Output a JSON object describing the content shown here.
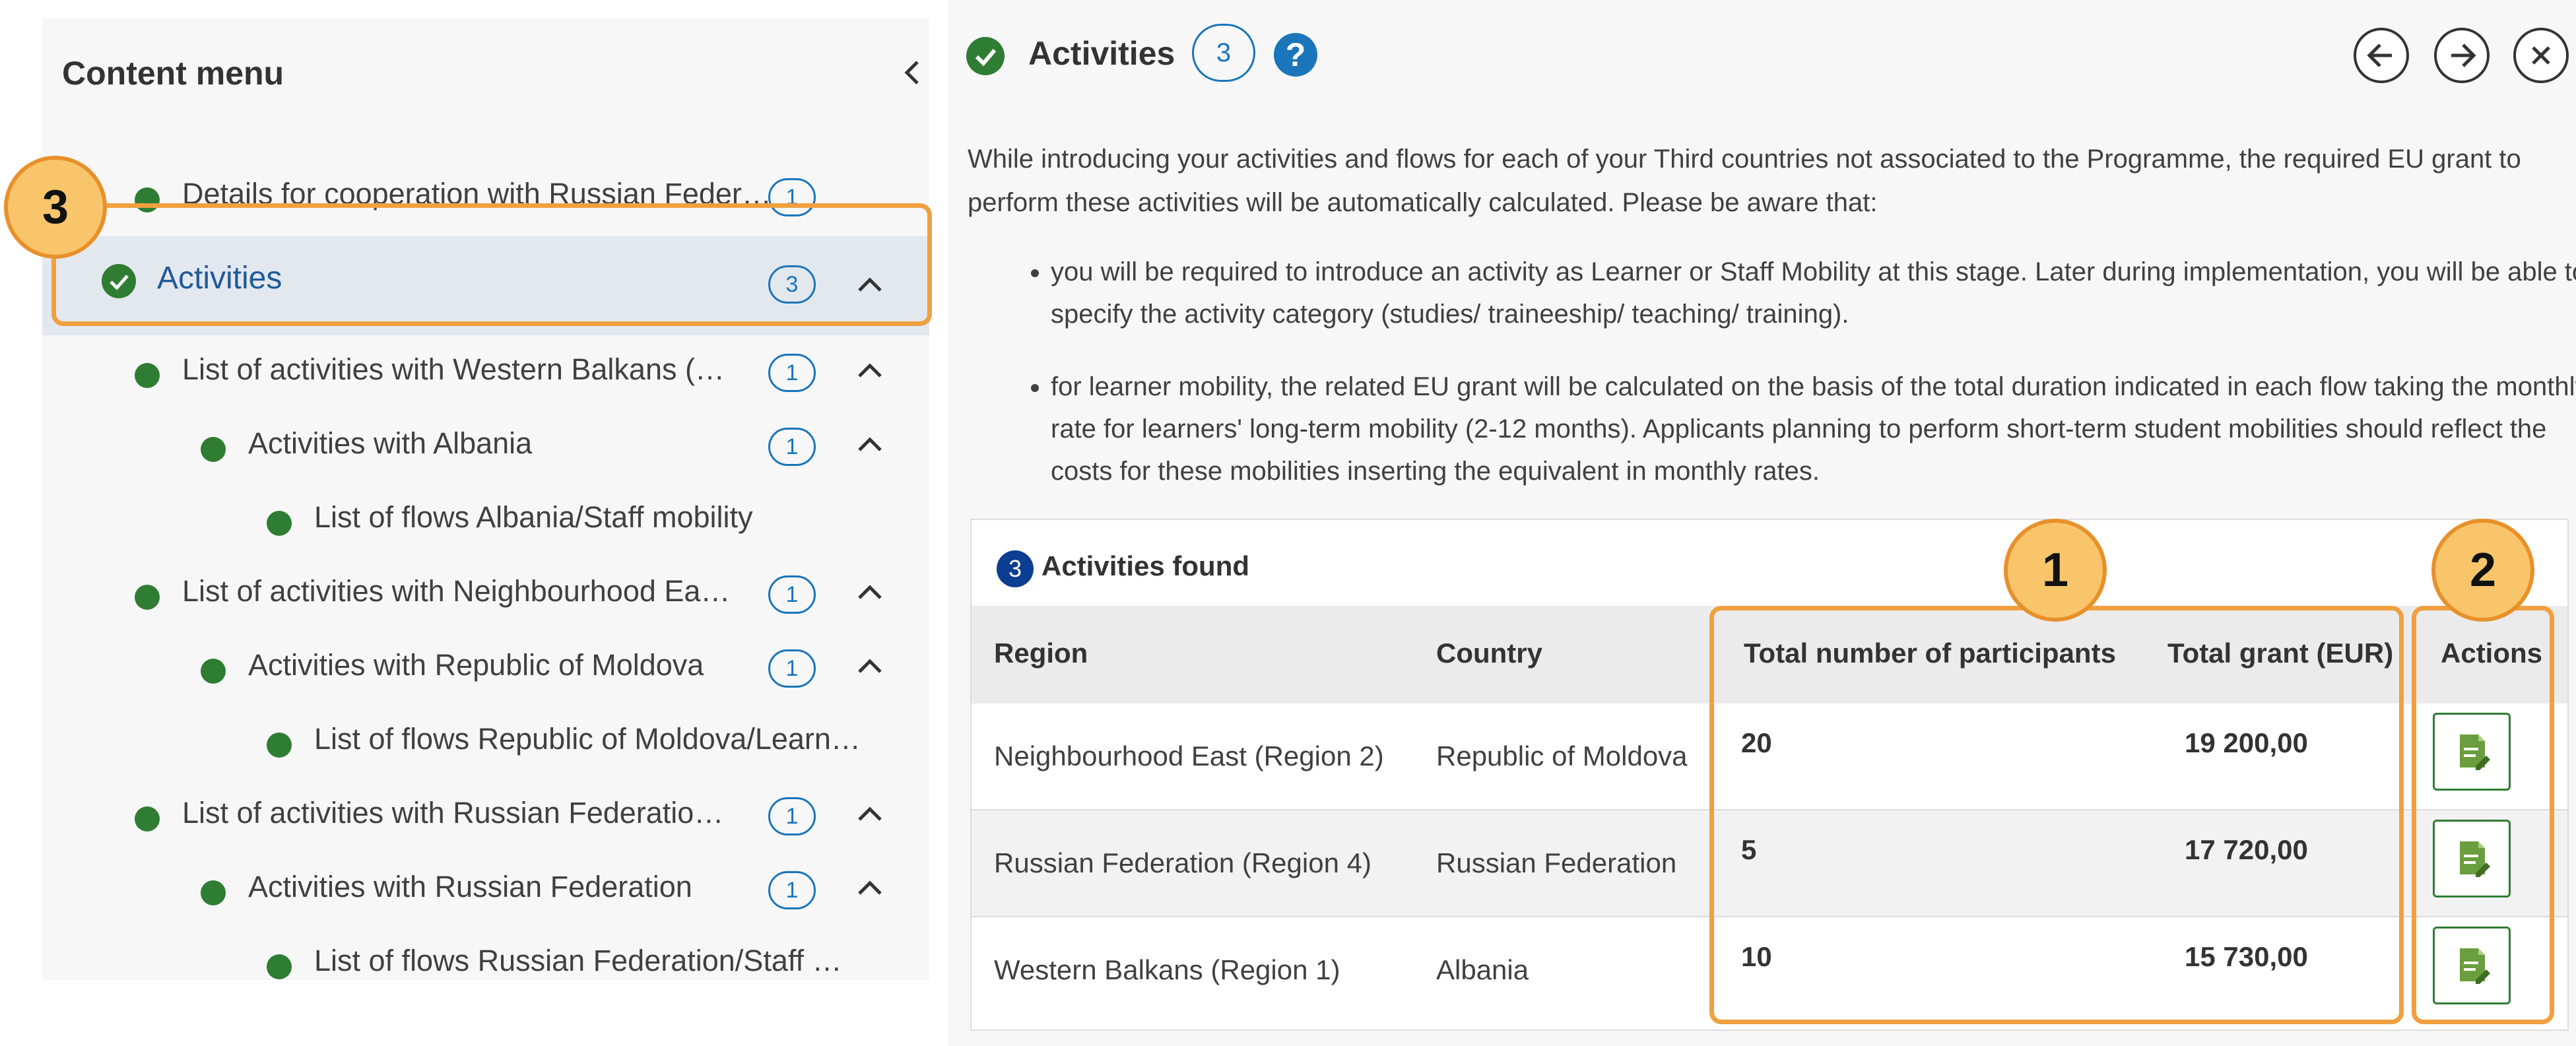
{
  "content_menu": {
    "title": "Content menu",
    "items": [
      {
        "label": "Details for cooperation with Russian Feder…",
        "count": "1"
      },
      {
        "label": "Activities",
        "count": "3"
      },
      {
        "label": "List of activities with Western Balkans (…",
        "count": "1"
      },
      {
        "label": "Activities with Albania",
        "count": "1"
      },
      {
        "label": "List of flows Albania/Staff mobility"
      },
      {
        "label": "List of activities with Neighbourhood Ea…",
        "count": "1"
      },
      {
        "label": "Activities with Republic of Moldova",
        "count": "1"
      },
      {
        "label": "List of flows Republic of Moldova/Learn…"
      },
      {
        "label": "List of activities with Russian Federatio…",
        "count": "1"
      },
      {
        "label": "Activities with Russian Federation",
        "count": "1"
      },
      {
        "label": "List of flows Russian Federation/Staff …"
      }
    ]
  },
  "panel": {
    "title": "Activities",
    "count": "3",
    "intro": "While introducing your activities and flows for each of your Third countries not associated to the Programme, the required EU grant to perform these activities will be automatically calculated. Please be aware that:",
    "bullets": [
      "you will be required to introduce an activity as Learner or Staff Mobility at this stage. Later during implementation, you will be able to specify the activity category (studies/ traineeship/ teaching/ training).",
      "for learner mobility, the related EU grant will be calculated on the basis of the total duration indicated in each flow taking the monthly rate for learners' long-term mobility (2-12 months). Applicants planning to perform short-term student mobilities should reflect the costs for these mobilities inserting the equivalent in monthly rates."
    ]
  },
  "table": {
    "found_count": "3",
    "found_label": "Activities found",
    "headers": {
      "region": "Region",
      "country": "Country",
      "participants": "Total number of participants",
      "grant": "Total grant (EUR)",
      "actions": "Actions"
    },
    "rows": [
      {
        "region": "Neighbourhood East (Region 2)",
        "country": "Republic of Moldova",
        "participants": "20",
        "grant": "19 200,00"
      },
      {
        "region": "Russian Federation (Region 4)",
        "country": "Russian Federation",
        "participants": "5",
        "grant": "17 720,00"
      },
      {
        "region": "Western Balkans (Region 1)",
        "country": "Albania",
        "participants": "10",
        "grant": "15 730,00"
      }
    ]
  },
  "markers": [
    "1",
    "2",
    "3"
  ],
  "colors": {
    "accent_orange": "#f0a040",
    "status_green": "#2e7d32",
    "link_blue": "#1a75bb"
  },
  "icons": {
    "back": "arrow-left-icon",
    "forward": "arrow-right-icon",
    "close": "close-icon",
    "help": "question-icon",
    "action": "edit-document-icon"
  }
}
